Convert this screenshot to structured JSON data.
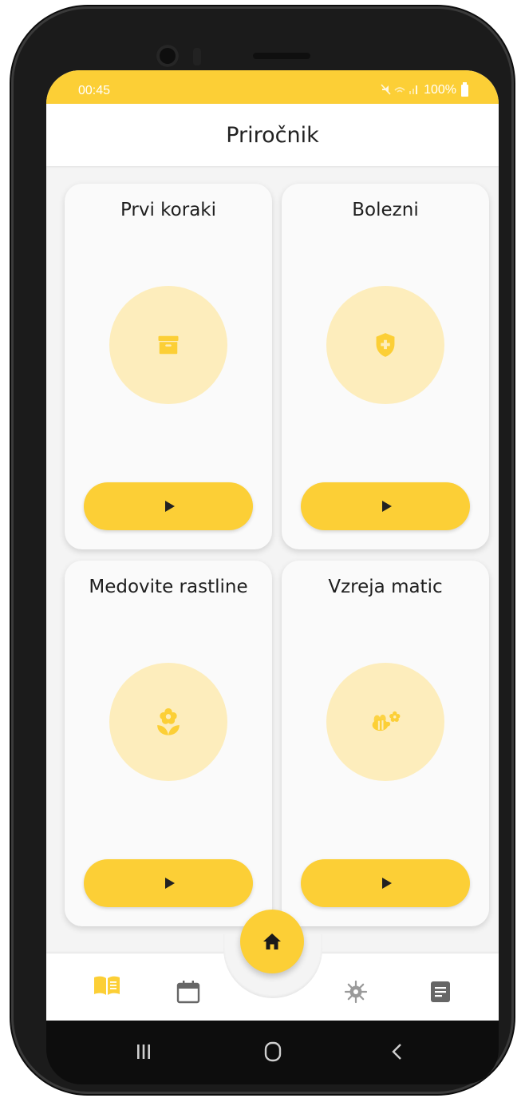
{
  "status_bar": {
    "time": "00:45",
    "battery": "100%",
    "icons": "mute, wifi, signal"
  },
  "app_bar": {
    "title": "Priročnik"
  },
  "cards": [
    {
      "title": "Prvi koraki",
      "icon": "archive-box-icon"
    },
    {
      "title": "Bolezni",
      "icon": "shield-plus-icon"
    },
    {
      "title": "Medovite rastline",
      "icon": "flower-icon"
    },
    {
      "title": "Vzreja matic",
      "icon": "bee-flower-icon"
    }
  ],
  "bottom_nav": {
    "items": [
      "book-open-icon",
      "calendar-icon",
      "home-icon",
      "gear-icon",
      "notes-icon"
    ],
    "active": "book-open-icon"
  },
  "colors": {
    "accent": "#fccf36",
    "icon_bg": "#fdedbc",
    "icon_fg": "#fccf36"
  }
}
